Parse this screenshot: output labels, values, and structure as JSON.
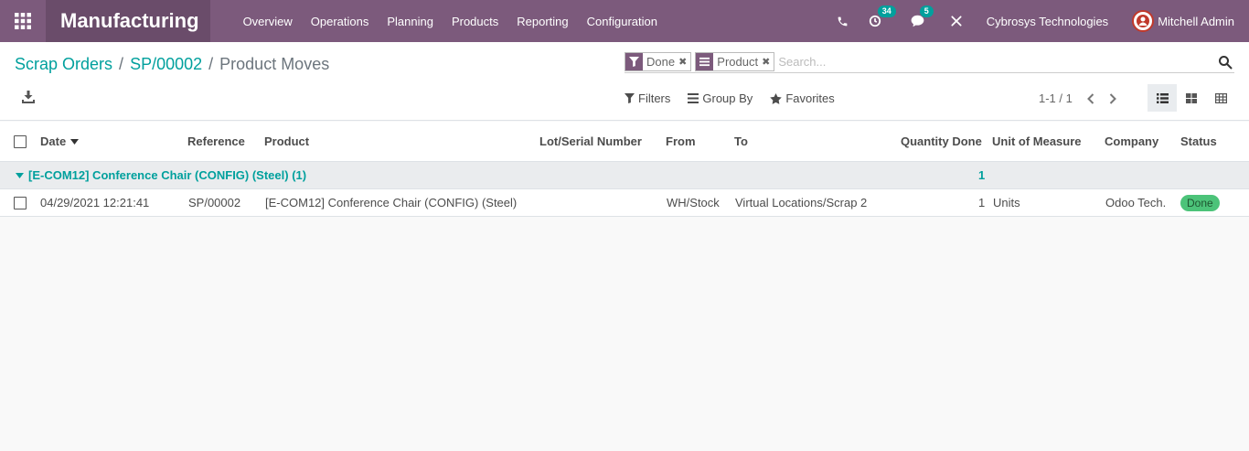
{
  "app": {
    "title": "Manufacturing"
  },
  "menu": [
    {
      "label": "Overview"
    },
    {
      "label": "Operations"
    },
    {
      "label": "Planning"
    },
    {
      "label": "Products"
    },
    {
      "label": "Reporting"
    },
    {
      "label": "Configuration"
    }
  ],
  "systray": {
    "activities_count": "34",
    "messages_count": "5",
    "company": "Cybrosys Technologies",
    "user": "Mitchell Admin"
  },
  "breadcrumb": {
    "items": [
      "Scrap Orders",
      "SP/00002"
    ],
    "separator": "/",
    "current": "Product Moves"
  },
  "search": {
    "facets": [
      {
        "icon": "filter-icon",
        "label": "Done"
      },
      {
        "icon": "group-icon",
        "label": "Product"
      }
    ],
    "placeholder": "Search..."
  },
  "controls": {
    "filters": "Filters",
    "group_by": "Group By",
    "favorites": "Favorites"
  },
  "pager": {
    "value": "1-1 / 1"
  },
  "table": {
    "headers": {
      "date": "Date",
      "reference": "Reference",
      "product": "Product",
      "lot": "Lot/Serial Number",
      "from": "From",
      "to": "To",
      "qty": "Quantity Done",
      "uom": "Unit of Measure",
      "company": "Company",
      "status": "Status"
    },
    "group": {
      "label": "[E-COM12] Conference Chair (CONFIG) (Steel) (1)",
      "qty": "1"
    },
    "rows": [
      {
        "date": "04/29/2021 12:21:41",
        "reference": "SP/00002",
        "product": "[E-COM12] Conference Chair (CONFIG) (Steel)",
        "lot": "",
        "from": "WH/Stock",
        "to": "Virtual Locations/Scrap 2",
        "qty": "1",
        "uom": "Units",
        "company": "Odoo Tech.",
        "status": "Done"
      }
    ]
  },
  "colors": {
    "brand": "#7c5a7c",
    "accent": "#00a09d",
    "status_done": "#4cc379"
  }
}
